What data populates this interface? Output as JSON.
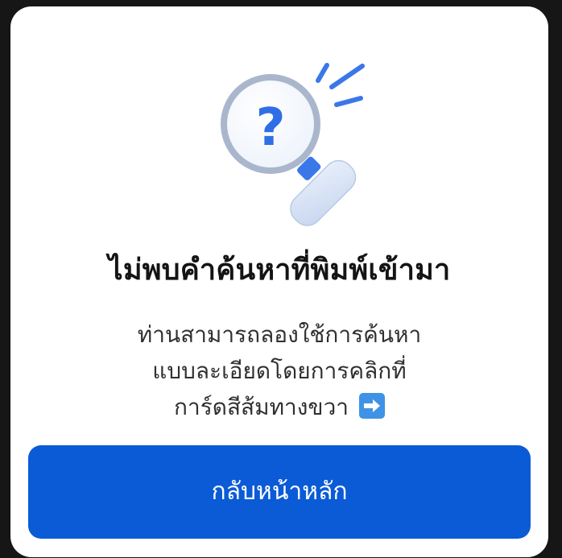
{
  "empty_state": {
    "icon": "magnifier-question-icon",
    "title": "ไม่พบคำค้นหาที่พิมพ์เข้ามา",
    "message_lines": [
      "ท่านสามารถลองใช้การค้นหา",
      "แบบละเอียดโดยการคลิกที่",
      "การ์ดสีส้มทางขวา"
    ],
    "message_arrow_icon": "right-arrow-icon",
    "button_label": "กลับหน้าหลัก"
  },
  "colors": {
    "background": "#161616",
    "card": "#ffffff",
    "button": "#0b5bd6",
    "button_text": "#ffffff",
    "title_text": "#141414",
    "message_text": "#303030",
    "arrow_badge": "#3f93e6",
    "magnifier_accent": "#3a78e8"
  }
}
